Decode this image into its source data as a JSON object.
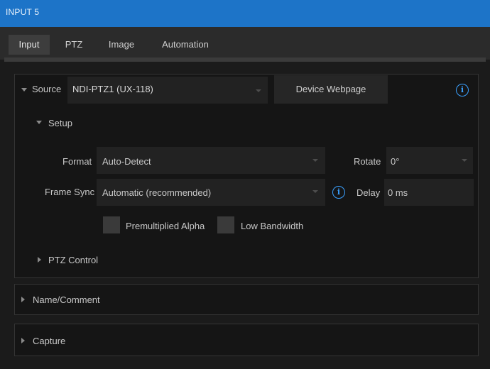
{
  "window": {
    "title": "INPUT 5"
  },
  "tabs": [
    {
      "label": "Input",
      "active": true
    },
    {
      "label": "PTZ",
      "active": false
    },
    {
      "label": "Image",
      "active": false
    },
    {
      "label": "Automation",
      "active": false
    }
  ],
  "source": {
    "label": "Source",
    "value": "NDI-PTZ1 (UX-118)",
    "device_webpage_label": "Device Webpage",
    "info_icon": "i"
  },
  "setup": {
    "label": "Setup",
    "format_label": "Format",
    "format_value": "Auto-Detect",
    "rotate_label": "Rotate",
    "rotate_value": "0°",
    "frame_sync_label": "Frame Sync",
    "frame_sync_value": "Automatic (recommended)",
    "frame_sync_info_icon": "i",
    "delay_label": "Delay",
    "delay_value": "0 ms",
    "premultiplied_alpha_label": "Premultiplied Alpha",
    "premultiplied_alpha_checked": false,
    "low_bandwidth_label": "Low Bandwidth",
    "low_bandwidth_checked": false
  },
  "ptz_control": {
    "label": "PTZ Control"
  },
  "name_comment": {
    "label": "Name/Comment"
  },
  "capture": {
    "label": "Capture"
  },
  "colors": {
    "accent": "#1d74c8",
    "background": "#1b1b1b",
    "panel": "#151515",
    "info": "#3aa0ff"
  }
}
